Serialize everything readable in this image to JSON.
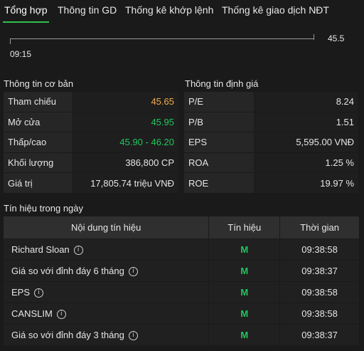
{
  "tabs": [
    "Tổng hợp",
    "Thông tin GD",
    "Thống kê khớp lệnh",
    "Thống kê giao dịch NĐT"
  ],
  "active_tab": "Tổng hợp",
  "chart": {
    "price": "45.5",
    "time": "09:15"
  },
  "basic_info": {
    "title": "Thông tin cơ bản",
    "rows": [
      {
        "label": "Tham chiếu",
        "value": "45.65",
        "color": "#f0ad4e"
      },
      {
        "label": "Mở cửa",
        "value": "45.95",
        "color": "#22c55e"
      },
      {
        "label": "Thấp/cao",
        "value": "45.90 - 46.20",
        "color": "#22c55e"
      },
      {
        "label": "Khối lượng",
        "value": "386,800 CP",
        "color": "#e6e6e6"
      },
      {
        "label": "Giá trị",
        "value": "17,805.74 triệu VNĐ",
        "color": "#e6e6e6"
      }
    ]
  },
  "valuation": {
    "title": "Thông tin định giá",
    "rows": [
      {
        "label": "P/E",
        "value": "8.24"
      },
      {
        "label": "P/B",
        "value": "1.51"
      },
      {
        "label": "EPS",
        "value": "5,595.00 VNĐ"
      },
      {
        "label": "ROA",
        "value": "1.25 %"
      },
      {
        "label": "ROE",
        "value": "19.97 %"
      }
    ]
  },
  "signals": {
    "title": "Tín hiệu trong ngày",
    "headers": [
      "Nội dung tín hiệu",
      "Tín hiệu",
      "Thời gian"
    ],
    "rows": [
      {
        "name": "Richard Sloan",
        "signal": "M",
        "time": "09:38:58"
      },
      {
        "name": "Giá so với đỉnh đáy 6 tháng",
        "signal": "M",
        "time": "09:38:37"
      },
      {
        "name": "EPS",
        "signal": "M",
        "time": "09:38:58"
      },
      {
        "name": "CANSLIM",
        "signal": "M",
        "time": "09:38:58"
      },
      {
        "name": "Giá so với đỉnh đáy 3 tháng",
        "signal": "M",
        "time": "09:38:37"
      }
    ]
  }
}
